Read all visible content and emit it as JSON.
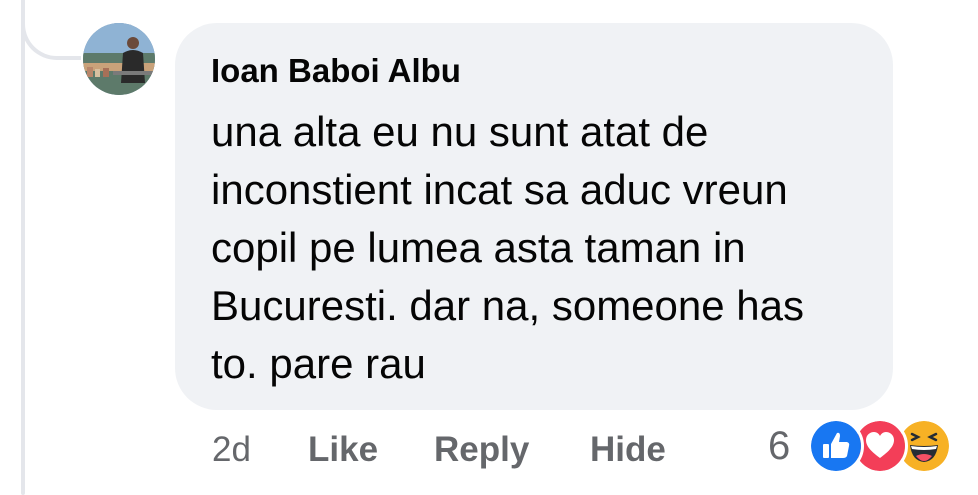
{
  "comment": {
    "author": "Ioan Baboi Albu",
    "text_lines": [
      "una alta eu nu sunt atat de",
      "inconstient incat sa aduc vreun",
      "copil pe lumea asta taman in",
      "Bucuresti. dar na, someone has",
      "to. pare rau"
    ],
    "avatar_icon": "profile-photo"
  },
  "actions": {
    "time": "2d",
    "like": "Like",
    "reply": "Reply",
    "hide": "Hide"
  },
  "reactions": {
    "count": "6",
    "types": [
      "like-icon",
      "love-icon",
      "haha-icon"
    ]
  },
  "colors": {
    "bubble": "#f0f2f5",
    "text": "#050505",
    "secondary": "#65676b",
    "like": "#1877f2",
    "love": "#f33e58",
    "haha": "#f7b125"
  }
}
